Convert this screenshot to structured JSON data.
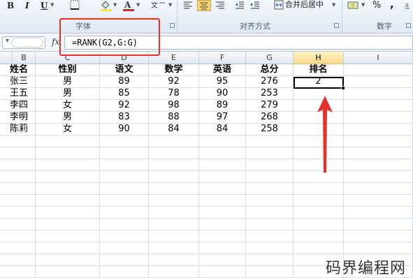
{
  "ribbon": {
    "bold": "B",
    "italic": "I",
    "underline": "U",
    "font_group": "字体",
    "align_group": "对齐方式",
    "merge_center": "合并后居中",
    "number_group": "数字",
    "percent": "%",
    "comma": ","
  },
  "formula_bar": {
    "fx": "fx",
    "formula": "=RANK(G2,G:G)"
  },
  "columns": [
    "B",
    "C",
    "D",
    "E",
    "F",
    "G",
    "H",
    "I"
  ],
  "active_column": "H",
  "table": {
    "headers": [
      "姓名",
      "性别",
      "语文",
      "数学",
      "英语",
      "总分",
      "排名"
    ],
    "rows": [
      [
        "张三",
        "男",
        "89",
        "92",
        "95",
        "276",
        "2"
      ],
      [
        "王五",
        "男",
        "85",
        "78",
        "90",
        "253",
        ""
      ],
      [
        "李四",
        "女",
        "92",
        "98",
        "89",
        "279",
        ""
      ],
      [
        "李明",
        "男",
        "83",
        "88",
        "97",
        "268",
        ""
      ],
      [
        "陈莉",
        "女",
        "90",
        "84",
        "84",
        "258",
        ""
      ]
    ]
  },
  "watermark": "码界编程网",
  "colors": {
    "highlight": "#e4322b",
    "selection": "#000000",
    "active_header": "#f9d889"
  }
}
